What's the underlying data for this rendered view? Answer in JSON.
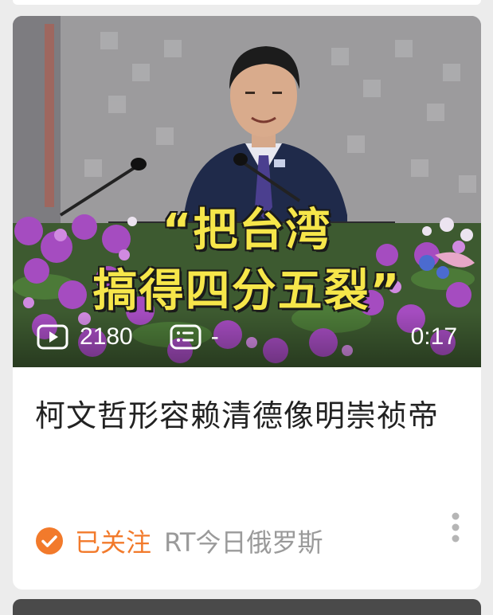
{
  "video": {
    "caption_line1": "“把台湾",
    "caption_line2": "搞得四分五裂”",
    "play_count": "2180",
    "danmaku_count": "-",
    "duration": "0:17",
    "icons": {
      "play": "play-icon",
      "danmaku": "danmaku-icon"
    }
  },
  "post": {
    "title": "柯文哲形容赖清德像明崇祯帝",
    "follow_status": "已关注",
    "author": "RT今日俄罗斯"
  },
  "colors": {
    "accent": "#f27a2b",
    "caption_text": "#f6e64a",
    "author_text": "#9a9a9a",
    "title_text": "#222222"
  }
}
